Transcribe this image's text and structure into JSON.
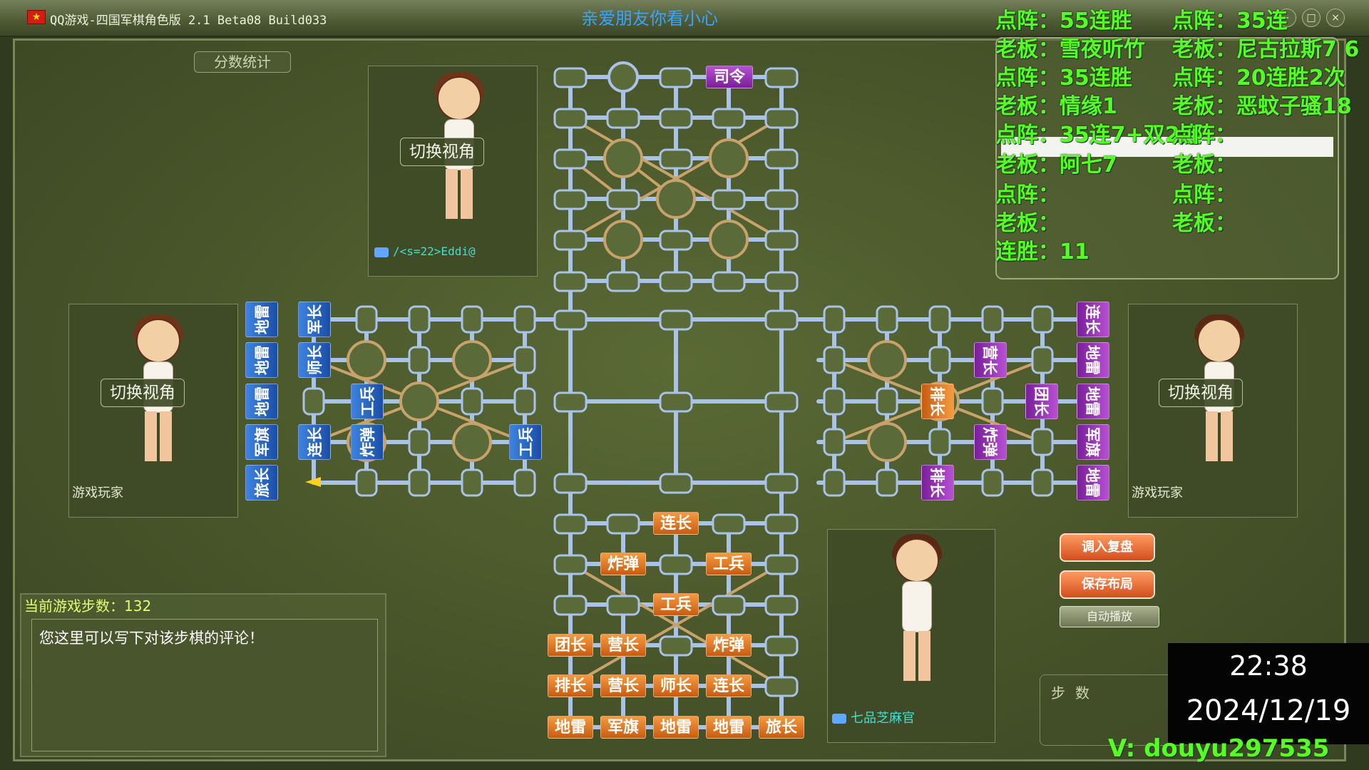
{
  "window": {
    "title": "QQ游戏-四国军棋角色版 2.1 Beta08 Build033",
    "banner": "亲爱朋友你看小心",
    "controls": [
      "-",
      "□",
      "×"
    ]
  },
  "score_tab": "分数统计",
  "players": {
    "top": {
      "view_button": "切换视角",
      "name": "/<s=22>Eddi@"
    },
    "left": {
      "view_button": "切换视角",
      "name": "游戏玩家"
    },
    "right": {
      "view_button": "切换视角",
      "name": "游戏玩家"
    },
    "bottom": {
      "name": "七品芝麻官"
    }
  },
  "pieces": {
    "purple_top": [
      "司令"
    ],
    "orange_bottom": [
      "连长",
      "炸弹",
      "工兵",
      "工兵",
      "团长",
      "营长",
      "炸弹",
      "排长",
      "营长",
      "师长",
      "连长",
      "地雷",
      "军旗",
      "地雷",
      "地雷",
      "旅长"
    ],
    "blue_left": [
      "地雷",
      "军长",
      "地雷",
      "师长",
      "地雷",
      "工兵",
      "军旗",
      "连长",
      "炸弹",
      "工兵",
      "旅长"
    ],
    "purple_right": [
      "连长",
      "营长",
      "地雷",
      "团长",
      "地雷",
      "排长",
      "炸弹",
      "军旗",
      "排长",
      "地雷"
    ]
  },
  "overlay_left": [
    "点阵：55连胜",
    "老板：雪夜听竹",
    "点阵：35连胜",
    "老板：情缘1",
    "点阵：35连7+双2连",
    "老板：阿七7",
    "点阵：",
    "老板：",
    "连胜：11"
  ],
  "overlay_right": [
    "点阵：35连",
    "老板：尼古拉斯7 6",
    "点阵：20连胜2次",
    "老板：恶蚊子骚18",
    "点阵：",
    "老板：",
    "点阵：",
    "老板："
  ],
  "comment": {
    "step_label": "当前游戏步数：132",
    "placeholder": "您这里可以写下对该步棋的评论！"
  },
  "buttons": {
    "load_replay": "调入复盘",
    "save_layout": "保存布局",
    "auto_play": "自动播放"
  },
  "steps_label": "步数",
  "clock": {
    "time": "22:38",
    "date": "2024/12/19"
  },
  "watermark": "V: douyu297535"
}
